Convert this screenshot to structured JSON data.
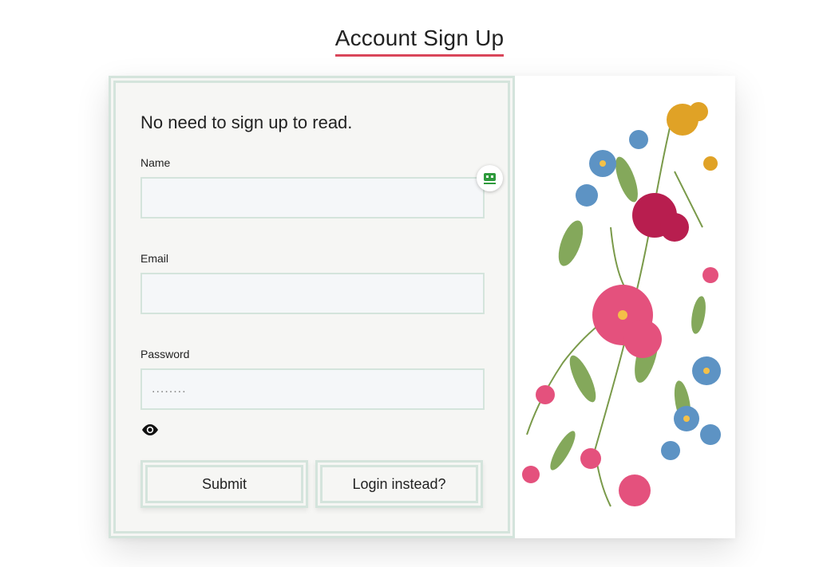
{
  "page": {
    "title": "Account Sign Up"
  },
  "form": {
    "subtitle": "No need to sign up to read.",
    "fields": {
      "name": {
        "label": "Name",
        "value": "",
        "placeholder": ""
      },
      "email": {
        "label": "Email",
        "value": "",
        "placeholder": ""
      },
      "password": {
        "label": "Password",
        "value": "",
        "placeholder": "........"
      }
    },
    "buttons": {
      "submit": "Submit",
      "login": "Login instead?"
    }
  },
  "icons": {
    "autofill": "contact-card-icon",
    "password_toggle": "eye-icon",
    "illustration": "floral-illustration"
  },
  "colors": {
    "title_underline": "#d9465a",
    "border": "#d4e4dc",
    "panel_bg": "#f6f6f4",
    "autofill_icon": "#2e9a3c"
  }
}
